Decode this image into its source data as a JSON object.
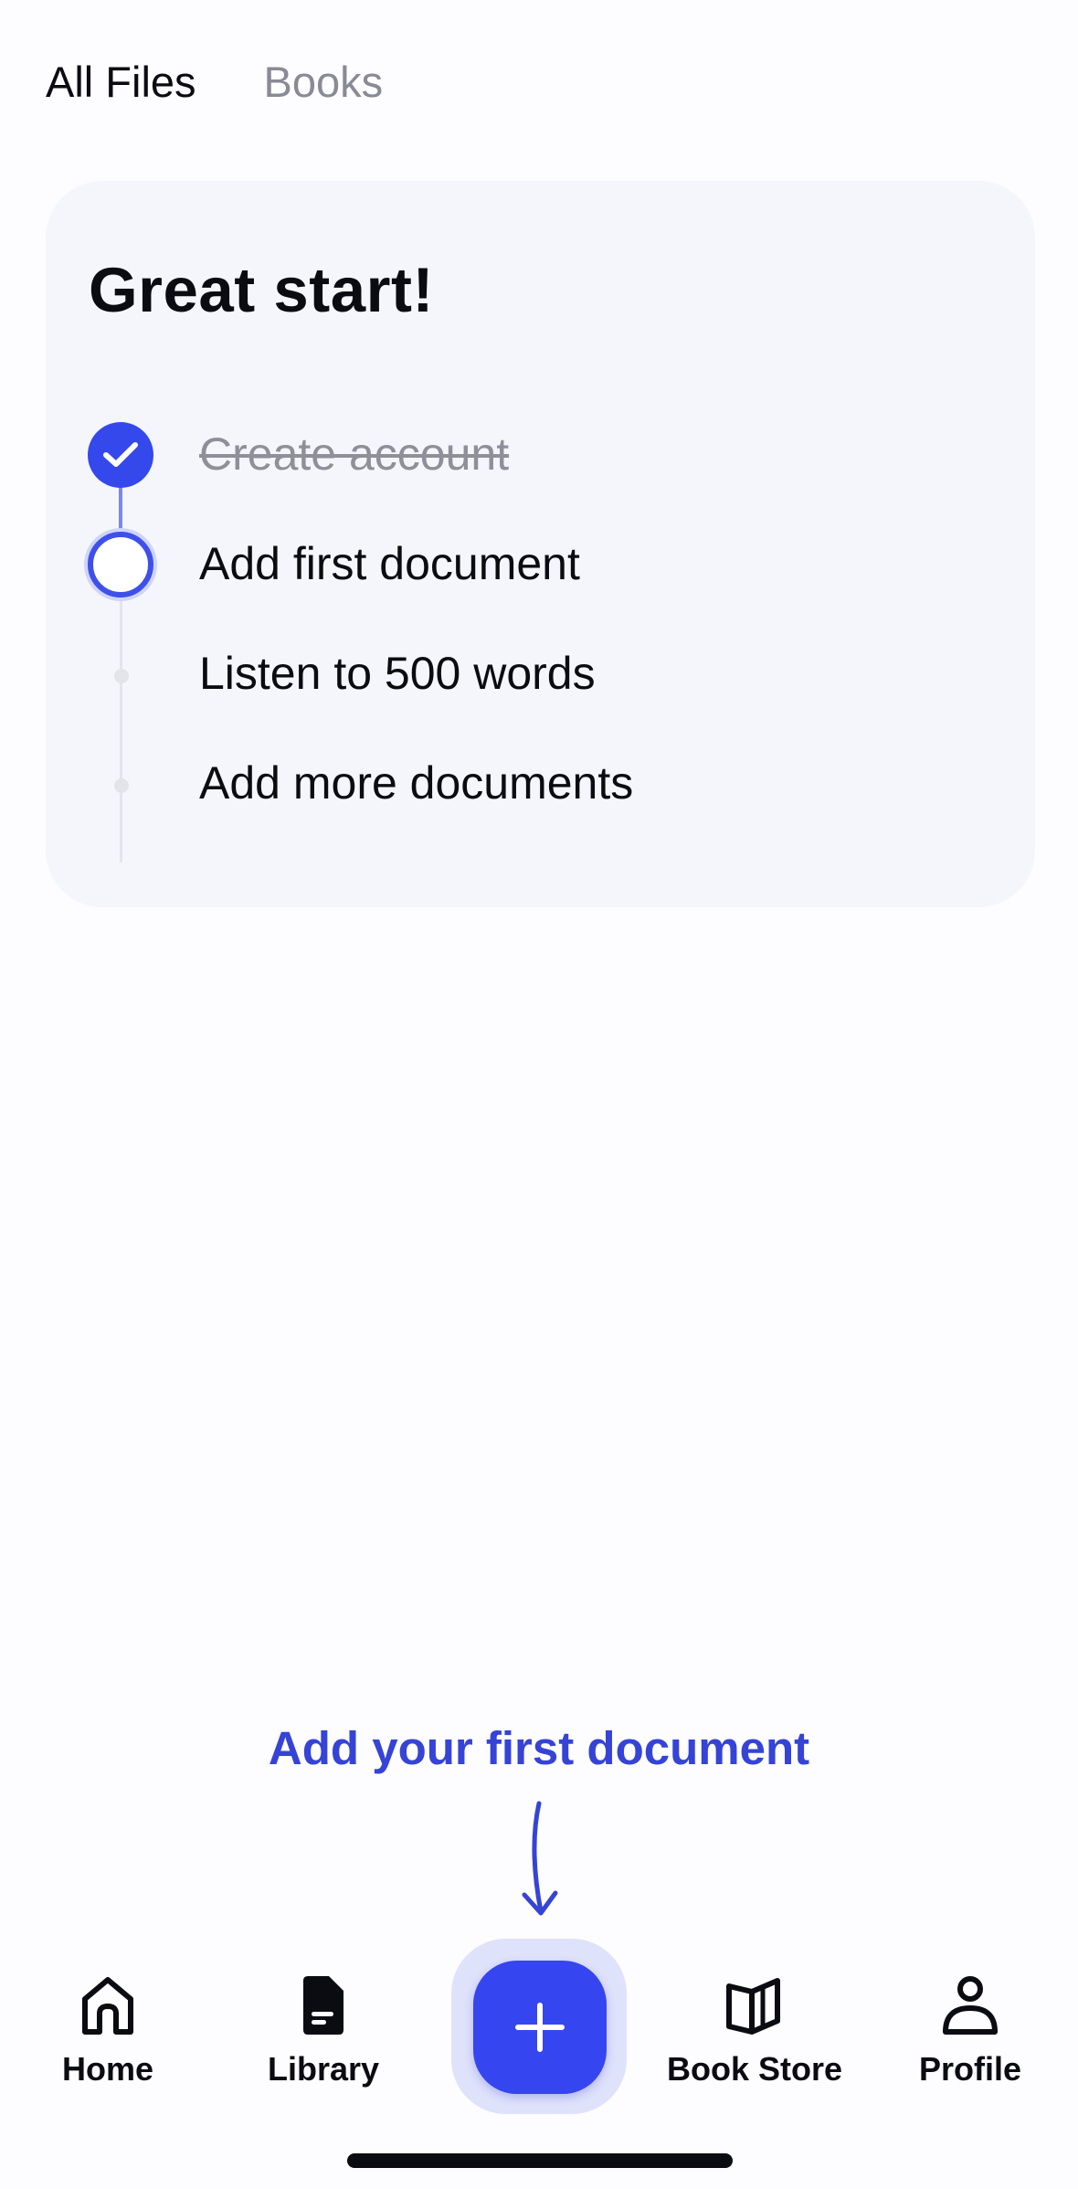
{
  "tabs": [
    {
      "label": "All Files",
      "active": true
    },
    {
      "label": "Books",
      "active": false
    }
  ],
  "checklist": {
    "title": "Great start!",
    "steps": [
      {
        "label": "Create account",
        "status": "done"
      },
      {
        "label": "Add first document",
        "status": "current"
      },
      {
        "label": "Listen to 500 words",
        "status": "pending"
      },
      {
        "label": "Add more documents",
        "status": "pending"
      }
    ]
  },
  "hint": {
    "text": "Add your first document"
  },
  "bottom_nav": {
    "items": [
      {
        "label": "Home",
        "icon": "home-icon"
      },
      {
        "label": "Library",
        "icon": "document-icon"
      },
      {
        "label": "Book Store",
        "icon": "book-icon"
      },
      {
        "label": "Profile",
        "icon": "person-icon"
      }
    ],
    "add_button_icon": "plus-icon"
  },
  "colors": {
    "accent": "#3546f0",
    "card_background": "#f5f6fc",
    "muted_text": "#8a8a96",
    "hint_text": "#3543d6"
  }
}
